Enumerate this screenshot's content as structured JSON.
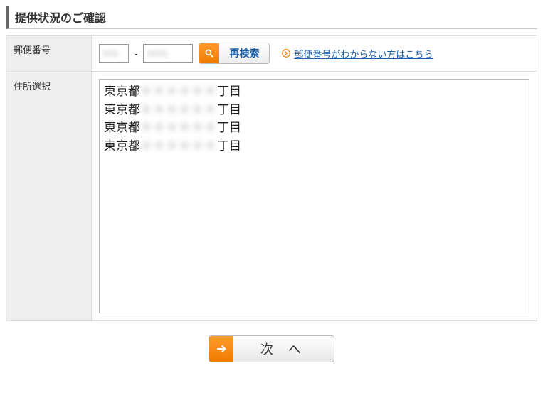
{
  "page": {
    "title": "提供状況のご確認"
  },
  "form": {
    "zip_label": "郵便番号",
    "zip_dash": "-",
    "zip_part1_value": "000",
    "zip_part2_value": "0000",
    "research_label": "再検索",
    "help_link": "郵便番号がわからない方はこちら",
    "address_label": "住所選択"
  },
  "addresses": [
    {
      "prefix": "東京都",
      "masked": "＊＊＊＊＊＊",
      "suffix": "丁目"
    },
    {
      "prefix": "東京都",
      "masked": "＊＊＊＊＊＊",
      "suffix": "丁目"
    },
    {
      "prefix": "東京都",
      "masked": "＊＊＊＊＊＊",
      "suffix": "丁目"
    },
    {
      "prefix": "東京都",
      "masked": "＊＊＊＊＊＊",
      "suffix": "丁目"
    }
  ],
  "footer": {
    "next_label": "次 へ"
  }
}
